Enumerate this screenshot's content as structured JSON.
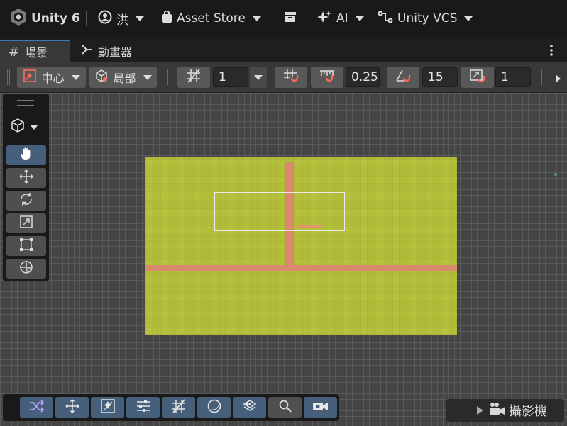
{
  "topbar": {
    "app_title": "Unity 6",
    "account_label": "洪",
    "asset_store_label": "Asset Store",
    "ai_label": "AI",
    "vcs_label": "Unity VCS"
  },
  "tabs": [
    {
      "label": "場景",
      "icon": "grid-icon",
      "active": true
    },
    {
      "label": "動畫器",
      "icon": "animator-icon",
      "active": false
    }
  ],
  "toolbar": {
    "pivot_label": "中心",
    "space_label": "局部",
    "grid_size_value": "1",
    "snap_move_value": "0.25",
    "snap_rotate_value": "15",
    "snap_scale_value": "1"
  },
  "overlay": {
    "camera_label": "攝影機"
  },
  "colors": {
    "accent": "#3a79bb",
    "active_tool": "#46607c",
    "ground": "#b6c23e",
    "road": "#d98a6e"
  }
}
